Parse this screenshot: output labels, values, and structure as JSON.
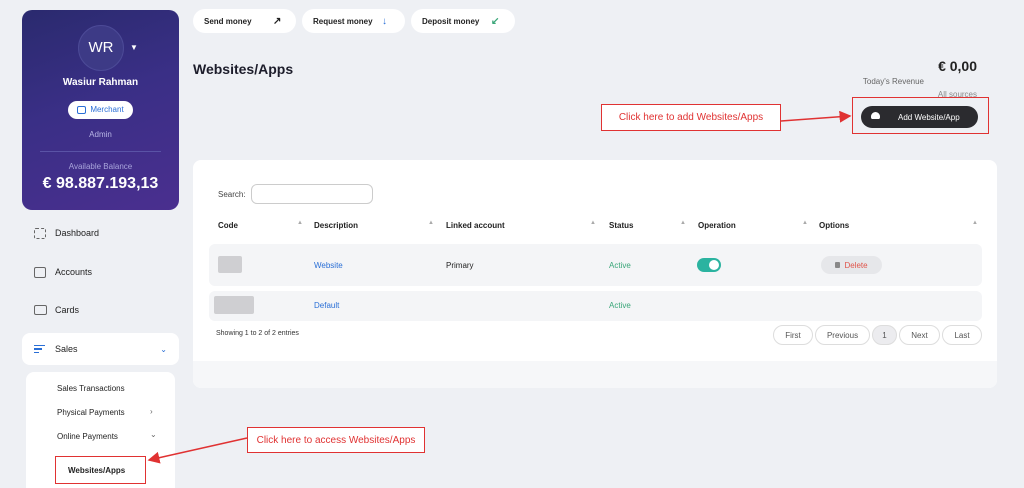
{
  "profile": {
    "initials": "WR",
    "name": "Wasiur Rahman",
    "badge": "Merchant",
    "role": "Admin",
    "balance_label": "Available Balance",
    "balance": "€ 98.887.193,13"
  },
  "sidebar": {
    "items": [
      {
        "label": "Dashboard",
        "icon": "grid-icon"
      },
      {
        "label": "Accounts",
        "icon": "wallet-icon"
      },
      {
        "label": "Cards",
        "icon": "card-icon"
      },
      {
        "label": "Sales",
        "icon": "sales-icon"
      }
    ],
    "submenu": [
      {
        "label": "Sales Transactions"
      },
      {
        "label": "Physical Payments"
      },
      {
        "label": "Online Payments"
      },
      {
        "label": "Websites/Apps"
      }
    ]
  },
  "actions": {
    "send": "Send money",
    "request": "Request money",
    "deposit": "Deposit money"
  },
  "page": {
    "title": "Websites/Apps",
    "revenue": "€ 0,00",
    "revenue_label": "Today's Revenue",
    "sources": "All sources",
    "add_button": "Add Website/App"
  },
  "table": {
    "search_label": "Search:",
    "search_value": "",
    "columns": [
      "Code",
      "Description",
      "Linked account",
      "Status",
      "Operation",
      "Options"
    ],
    "rows": [
      {
        "description": "Website",
        "linked_account": "Primary",
        "status": "Active",
        "operation_on": true,
        "option": "Delete"
      },
      {
        "description": "Default",
        "linked_account": "",
        "status": "Active"
      }
    ],
    "entries": "Showing 1 to 2 of 2 entries",
    "pagination": {
      "first": "First",
      "previous": "Previous",
      "current": "1",
      "next": "Next",
      "last": "Last"
    }
  },
  "annotations": {
    "add_callout": "Click here to add Websites/Apps",
    "access_callout": "Click here to access Websites/Apps"
  },
  "colors": {
    "accent": "#2a6fd6",
    "annotation": "#e03232",
    "toggle_on": "#2bb3a0",
    "status_active": "#3aa679"
  }
}
